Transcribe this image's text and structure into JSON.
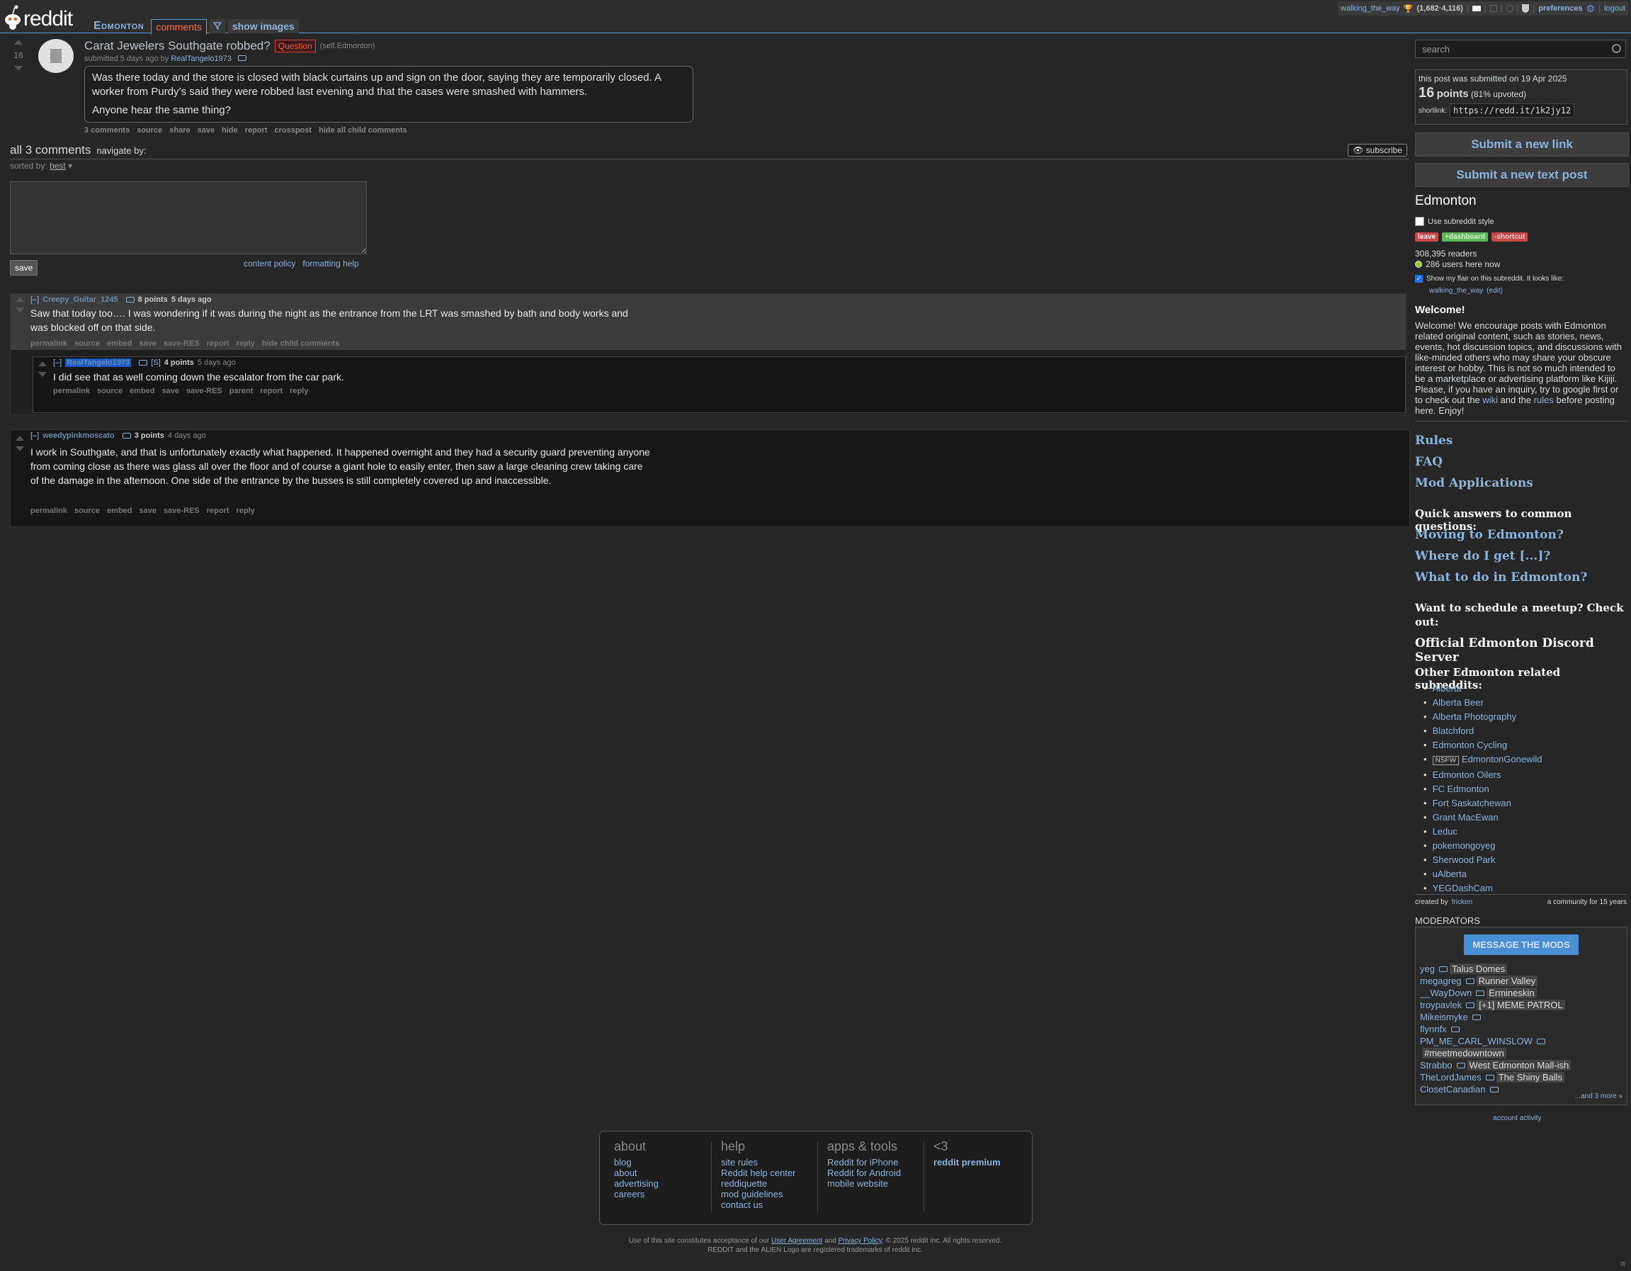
{
  "header": {
    "wordmark": "reddit",
    "tabs": {
      "subreddit": "Edmonton",
      "comments": "comments",
      "filter_icon": "filter-icon",
      "show_images": "show images"
    },
    "user": {
      "name": "walking_the_way",
      "karma": "(1,682·4,116)",
      "preferences": "preferences",
      "logout": "logout"
    }
  },
  "post": {
    "score": "16",
    "title": "Carat Jewelers Southgate robbed?",
    "flair": "Question",
    "domain": "(self.Edmonton)",
    "submitted": "submitted 5 days ago by",
    "author": "RealTangelo1973",
    "selftext": [
      "Was there today and the store is closed with black curtains up and sign on the door, saying they are temporarily closed. A worker from Purdy’s said they were robbed last evening and that the cases were smashed with hammers.",
      "Anyone hear the same thing?"
    ],
    "buttons": [
      "3 comments",
      "source",
      "share",
      "save",
      "hide",
      "report",
      "crosspost",
      "hide all child comments"
    ]
  },
  "comments_area": {
    "heading": "all 3 comments",
    "navigate": "navigate by:",
    "subscribe": "subscribe",
    "sorted_label": "sorted by:",
    "sorted_value": "best",
    "save": "save",
    "content_policy": "content policy",
    "formatting_help": "formatting help"
  },
  "comments": [
    {
      "collapse": "[–]",
      "author": "Creepy_Guitar_1245",
      "points": "8 points",
      "age": "5 days ago",
      "body": "Saw that today too…. I was wondering if it was during the night as the entrance from the LRT was smashed by bath and body works and was blocked off on that side.",
      "buttons": [
        "permalink",
        "source",
        "embed",
        "save",
        "save-RES",
        "report",
        "reply",
        "hide child comments"
      ]
    },
    {
      "collapse": "[–]",
      "author": "RealTangelo1973",
      "op_marker": "[S]",
      "points": "4 points",
      "age": "5 days ago",
      "body": "I did see that as well coming down the escalator from the car park.",
      "buttons": [
        "permalink",
        "source",
        "embed",
        "save",
        "save-RES",
        "parent",
        "report",
        "reply"
      ]
    },
    {
      "collapse": "[–]",
      "author": "weedypinkmoscato",
      "points": "3 points",
      "age": "4 days ago",
      "body": "I work in Southgate, and that is unfortunately exactly what happened. It happened overnight and they had a security guard preventing anyone from coming close as there was glass all over the floor and of course a giant hole to easily enter, then saw a large cleaning crew taking care of the damage in the afternoon. One side of the entrance by the busses is still completely covered up and inaccessible.",
      "buttons": [
        "permalink",
        "source",
        "embed",
        "save",
        "save-RES",
        "report",
        "reply"
      ]
    }
  ],
  "sidebar": {
    "search_placeholder": "search",
    "submitted_on": "this post was submitted on 19 Apr 2025",
    "points": "16",
    "points_word": "points",
    "upvoted": "(81% upvoted)",
    "shortlink_label": "shortlink:",
    "shortlink": "https://redd.it/1k2jy12",
    "submit_link": "Submit a new link",
    "submit_text": "Submit a new text post",
    "subreddit": "Edmonton",
    "use_style": "Use subreddit style",
    "leave": "leave",
    "dashboard": "+dashboard",
    "shortcut": "-shortcut",
    "readers": "308,395 readers",
    "online": "286 users here now",
    "flair_toggle": "Show my flair on this subreddit. It looks like:",
    "flair_user": "walking_the_way",
    "flair_edit": "(edit)",
    "welcome_title": "Welcome!",
    "welcome_text": "Welcome! We encourage posts with Edmonton related original content, such as stories, news, events, hot discussion topics, and discussions with like-minded others who may share your obscure interest or hobby. This is not so much intended to be a marketplace or advertising platform like Kijiji. Please, if you have an inquiry, try to google first or to check out the",
    "welcome_wiki": "wiki",
    "welcome_and": "and the",
    "welcome_rules": "rules",
    "welcome_end": "before posting here. Enjoy!",
    "links": [
      "Rules",
      "FAQ",
      "Mod Applications"
    ],
    "quick_heading": "Quick answers to common questions:",
    "quick_links": [
      "Moving to Edmonton?",
      "Where do I get [...]?",
      "What to do in Edmonton?"
    ],
    "meetup_heading": "Want to schedule a meetup? Check out:",
    "discord": "Official Edmonton Discord Server",
    "related_heading": "Other Edmonton related subreddits:",
    "related": [
      "Alberta",
      "Alberta Beer",
      "Alberta Photography",
      "Blatchford",
      "Edmonton Cycling",
      "EdmontonGonewild",
      "Edmonton Oilers",
      "FC Edmonton",
      "Fort Saskatchewan",
      "Grant MacEwan",
      "Leduc",
      "pokemongoyeg",
      "Sherwood Park",
      "uAlberta",
      "YEGDashCam"
    ],
    "nsfw": "NSFW",
    "created_by": "created by",
    "creator": "fricken",
    "community_age": "a community for 15 years",
    "moderators_heading": "MODERATORS",
    "message_mods": "MESSAGE THE MODS",
    "mods": [
      {
        "name": "yeg",
        "flair": "Talus Domes"
      },
      {
        "name": "megagreg",
        "flair": "Runner Valley"
      },
      {
        "name": "__WayDown",
        "flair": "Ermineskin"
      },
      {
        "name": "troypavlek",
        "flair": "[+1] MEME PATROL"
      },
      {
        "name": "Mikeismyke",
        "flair": ""
      },
      {
        "name": "flynnfx",
        "flair": ""
      },
      {
        "name": "PM_ME_CARL_WINSLOW",
        "flair": ""
      },
      {
        "name": "",
        "flair": "#meetmedowntown"
      },
      {
        "name": "Strabbo",
        "flair": "West Edmonton Mall-ish"
      },
      {
        "name": "TheLordJames",
        "flair": "The Shiny Balls"
      },
      {
        "name": "ClosetCanadian",
        "flair": ""
      }
    ],
    "more_mods": "...and 3 more »",
    "account_activity": "account activity"
  },
  "footer": {
    "about": {
      "title": "about",
      "links": [
        "blog",
        "about",
        "advertising",
        "careers"
      ]
    },
    "help": {
      "title": "help",
      "links": [
        "site rules",
        "Reddit help center",
        "reddiquette",
        "mod guidelines",
        "contact us"
      ]
    },
    "apps": {
      "title": "apps & tools",
      "links": [
        "Reddit for iPhone",
        "Reddit for Android",
        "mobile website"
      ]
    },
    "love": {
      "title": "<3",
      "links": [
        "reddit premium"
      ]
    },
    "legal_1": "Use of this site constitutes acceptance of our",
    "user_agreement": "User Agreement",
    "and": "and",
    "privacy": "Privacy Policy",
    "legal_2": ". © 2025 reddit inc. All rights reserved.",
    "legal_3": "REDDIT and the ALIEN Logo are registered trademarks of reddit inc."
  },
  "colors": {
    "accent": "#5f99cf",
    "link": "#8cb3d9",
    "flair_red": "#e53e30",
    "op": "#1b59c4"
  }
}
